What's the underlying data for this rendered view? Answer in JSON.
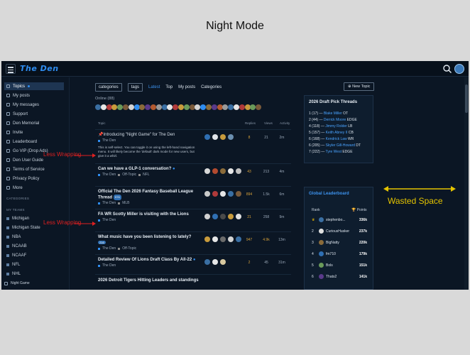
{
  "caption": "Night Mode",
  "app": {
    "logo": "The Den",
    "icons": {
      "menu": "hamburger-icon",
      "search": "search-icon"
    }
  },
  "sidebar": {
    "items": [
      {
        "label": "Topics",
        "active": true
      },
      {
        "label": "My posts"
      },
      {
        "label": "My messages"
      },
      {
        "label": "Support"
      },
      {
        "label": "Den Memorial"
      },
      {
        "label": "Invite"
      },
      {
        "label": "Leaderboard"
      },
      {
        "label": "Go VIP (Drop Ads)"
      },
      {
        "label": "Den User Guide"
      },
      {
        "label": "Terms of Service"
      },
      {
        "label": "Privacy Policy"
      },
      {
        "label": "More"
      }
    ],
    "categories_heading": "CATEGORIES",
    "teams_heading": "MY TEAMS",
    "teams": [
      "Michigan",
      "Michigan State",
      "NBA",
      "NCAAB",
      "NCAAF",
      "NFL",
      "NHL"
    ],
    "footer_label": "Night Game"
  },
  "nav": {
    "categories": "categories",
    "tags": "tags",
    "latest": "Latest",
    "top": "Top",
    "my_posts": "My posts",
    "categories_link": "Categories",
    "new_topic": "New Topic"
  },
  "online": "Online (88)",
  "table_headers": {
    "topic": "Topic",
    "replies": "Replies",
    "views": "Views",
    "activity": "Activity"
  },
  "topics": [
    {
      "title": "Introducing \"Night Game\" for The Den",
      "category": "The Den",
      "excerpt": "This is self-select. You can toggle it on using the left-hand navigation menu. It will likely become the 'default' dark mode for new users, but give it a whirl.",
      "replies": "8",
      "views": "21",
      "activity": "2m"
    },
    {
      "title": "Can we have a GLP-1 conversation?",
      "category": "The Den",
      "tag1": "Off-Topic",
      "tag2": "NFL",
      "replies": "43",
      "views": "213",
      "activity": "4m"
    },
    {
      "title": "Official The Den 2026 Fantasy Baseball League Thread",
      "badge": "576",
      "category": "The Den",
      "tag1": "MLB",
      "replies": "894",
      "views": "1.5k",
      "activity": "6m"
    },
    {
      "title": "FA WR Scotty Miller is visiting with the Lions",
      "category": "The Den",
      "replies": "21",
      "views": "258",
      "activity": "9m"
    },
    {
      "title": "What music have you been listening to lately?",
      "badge": "216",
      "category": "The Den",
      "tag1": "Off-Topic",
      "replies": "947",
      "views": "4.9k",
      "activity": "13m"
    },
    {
      "title": "Detailed Review Of Lions Draft Class By All-22",
      "category": "The Den",
      "replies": "2",
      "views": "45",
      "activity": "31m"
    },
    {
      "title": "2026 Detroit Tigers Hitting Leaders and standings"
    }
  ],
  "draft_panel": {
    "title": "2026 Draft Pick Threads",
    "rows": [
      {
        "pick": "1 (17) —",
        "name": "Blake Miller",
        "pos": "OT"
      },
      {
        "pick": "2 (44) —",
        "name": "Derrick Moore",
        "pos": "EDGE"
      },
      {
        "pick": "4 (118) —",
        "name": "Jimmy Rolder",
        "pos": "LB"
      },
      {
        "pick": "5 (157) —",
        "name": "Keith Abney II",
        "pos": "CB"
      },
      {
        "pick": "6 (168) —",
        "name": "Kendrick Law",
        "pos": "WR"
      },
      {
        "pick": "6 (205) —",
        "name": "Skyler Gill-Howard",
        "pos": "DT"
      },
      {
        "pick": "7 (222) —",
        "name": "Tyre West",
        "pos": "EDGE"
      }
    ]
  },
  "leaderboard": {
    "title": "Global Leaderboard",
    "rank_header": "Rank",
    "points_header": "Points",
    "rows": [
      {
        "rank": "",
        "name": "stephenbo...",
        "points": "336k"
      },
      {
        "rank": "2",
        "name": "CuriousHusker",
        "points": "237k"
      },
      {
        "rank": "3",
        "name": "BigNatty",
        "points": "220k"
      },
      {
        "rank": "4",
        "name": "fm710",
        "points": "179k"
      },
      {
        "rank": "5",
        "name": "Bols",
        "points": "151k"
      },
      {
        "rank": "6",
        "name": "Thats2",
        "points": "141k"
      }
    ]
  },
  "annotations": {
    "less_wrapping_1": "Less Wrapping",
    "less_wrapping_2": "Less Wrapping",
    "wasted_space": "Wasted Space"
  },
  "colors": {
    "accent": "#2f8df0",
    "annotation_red": "#e02020",
    "annotation_yellow": "#e5c400"
  }
}
